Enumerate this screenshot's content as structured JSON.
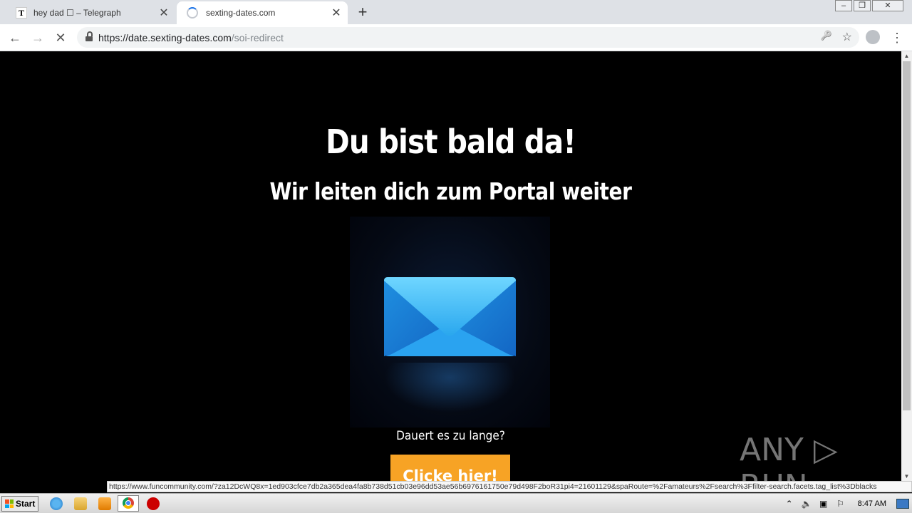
{
  "browser": {
    "tabs": [
      {
        "favicon": "T",
        "title": "hey dad ☐ – Telegraph",
        "close": "✕"
      },
      {
        "title": "sexting-dates.com",
        "close": "✕",
        "loading": true
      }
    ],
    "new_tab": "+",
    "window_controls": {
      "minimize": "‒",
      "restore": "❐",
      "close": "✕"
    },
    "nav": {
      "back": "←",
      "forward": "→",
      "stop": "✕",
      "menu": "⋮"
    },
    "url": {
      "host": "https://date.sexting-dates.com",
      "path": "/soi-redirect"
    },
    "omnibox_icons": {
      "key": "🔑",
      "star": "☆"
    }
  },
  "page": {
    "heading": "Du bist bald da!",
    "subheading": "Wir leiten dich zum Portal weiter",
    "wait_text": "Dauert es zu lange?",
    "button_label": "Clicke hier!",
    "watermark": "ANY ▷ RUN"
  },
  "status_url": "https://www.funcommunity.com/?za12DcWQ8x=1ed903cfce7db2a365dea4fa8b738d51cb03e96dd53ae56b6976161750e79d498F2boR31pi4=21601129&spaRoute=%2Famateurs%2Fsearch%3Ffilter-search.facets.tag_list%3Dblacks",
  "taskbar": {
    "start_label": "Start",
    "tray_icons": {
      "arrow": "⌃",
      "volume": "🔈",
      "network": "▣",
      "flag": "⚐"
    },
    "clock": "8:47 AM"
  },
  "colors": {
    "button": "#f7a325",
    "envelope": "#2aa7ee",
    "page_bg": "#000000"
  }
}
